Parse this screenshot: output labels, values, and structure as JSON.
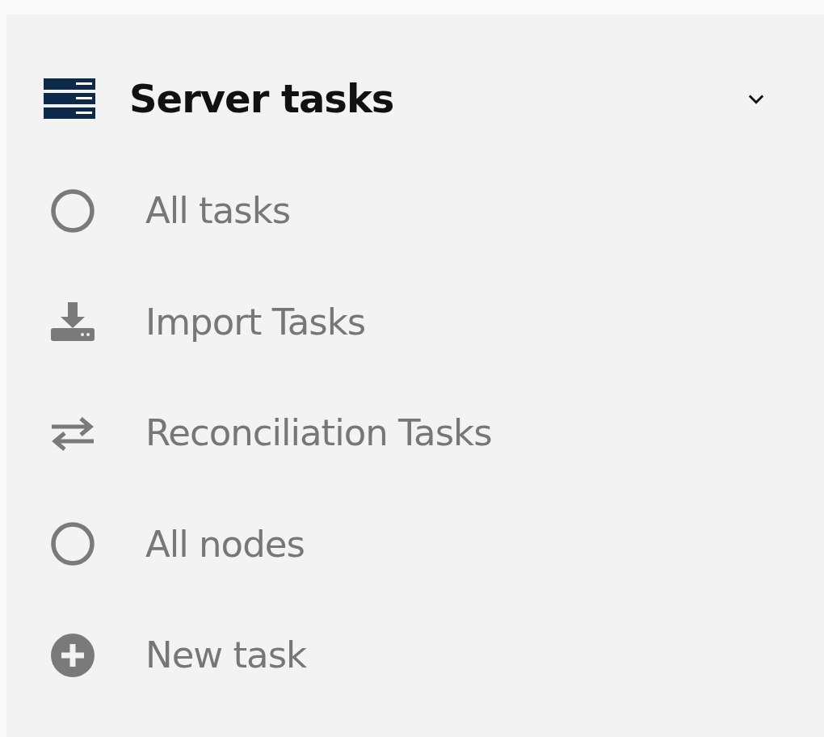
{
  "section": {
    "title": "Server tasks",
    "expanded": true
  },
  "items": [
    {
      "label": "All tasks",
      "kind": "circle"
    },
    {
      "label": "Import Tasks",
      "kind": "download"
    },
    {
      "label": "Reconciliation Tasks",
      "kind": "transfer"
    },
    {
      "label": "All nodes",
      "kind": "circle"
    },
    {
      "label": "New task",
      "kind": "add"
    }
  ]
}
